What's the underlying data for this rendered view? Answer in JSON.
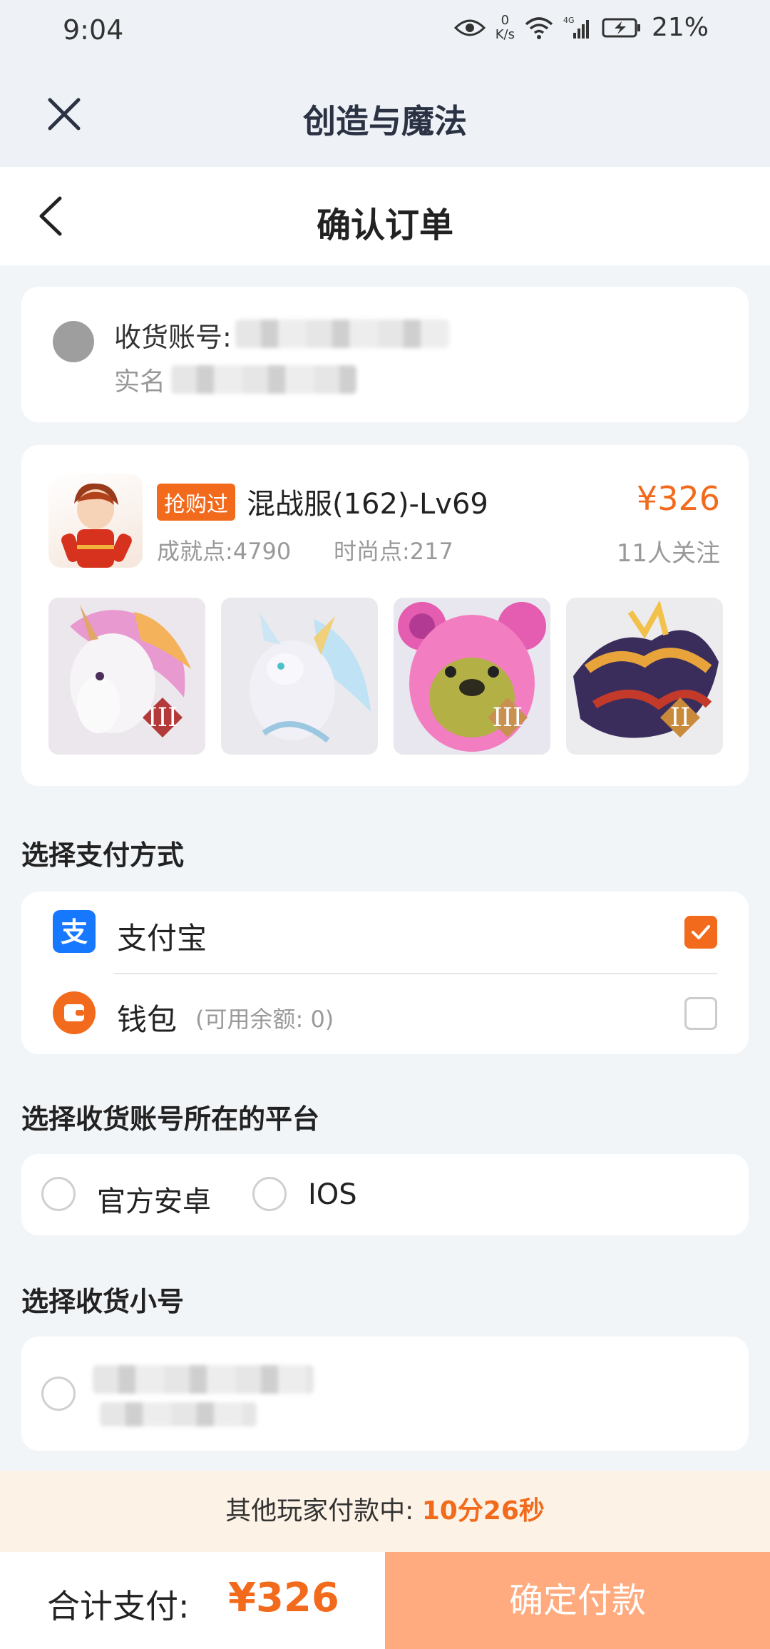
{
  "status_bar": {
    "time": "9:04",
    "net_speed_value": "0",
    "net_speed_unit": "K/s",
    "network": "4G",
    "battery": "21%"
  },
  "app_bar": {
    "title": "创造与魔法",
    "close_icon": "close-icon"
  },
  "page": {
    "title": "确认订单",
    "back_icon": "chevron-left-icon"
  },
  "receiver": {
    "account_label": "收货账号:",
    "name_label": "实名"
  },
  "product": {
    "tag": "抢购过",
    "name": "混战服(162)-Lv69",
    "price": "¥326",
    "achievement": "成就点:4790",
    "fashion": "时尚点:217",
    "followers": "11人关注",
    "thumb_badges": [
      "III",
      "",
      "III",
      "II"
    ]
  },
  "payment": {
    "section_title": "选择支付方式",
    "options": [
      {
        "label": "支付宝",
        "sub": "",
        "checked": true
      },
      {
        "label": "钱包",
        "sub": "(可用余额: 0)",
        "checked": false
      }
    ]
  },
  "platform": {
    "section_title": "选择收货账号所在的平台",
    "options": [
      "官方安卓",
      "IOS"
    ]
  },
  "alt_account": {
    "section_title": "选择收货小号"
  },
  "countdown": {
    "label": "其他玩家付款中:",
    "time": "10分26秒"
  },
  "bottom": {
    "total_label": "合计支付:",
    "total_amount": "¥326",
    "confirm_label": "确定付款"
  },
  "colors": {
    "accent": "#f26a1b",
    "button": "#ffab7f",
    "alipay": "#1677ff"
  }
}
